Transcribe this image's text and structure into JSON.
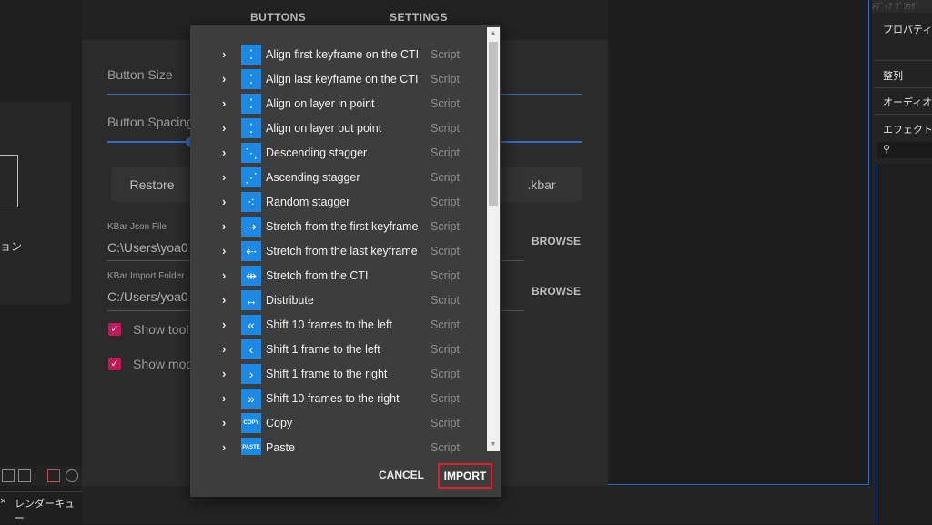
{
  "settings": {
    "tabs": [
      "BUTTONS",
      "SETTINGS"
    ],
    "button_size_label": "Button Size",
    "button_spacing_label": "Button Spacing",
    "restore_label": "Restore",
    "kbar_label": ".kbar",
    "json_file_label": "KBar Json File",
    "json_file_value": "C:\\Users\\yoa0",
    "import_folder_label": "KBar Import Folder",
    "import_folder_value": "C:/Users/yoa0",
    "browse_label": "BROWSE",
    "show_tool_label": "Show tool",
    "show_mod_label": "Show mod"
  },
  "left_panel": {
    "label": "ョン",
    "tab_label": "レンダーキュー",
    "tab_close": "×"
  },
  "right_panel": {
    "top_text": "ﾒﾃﾞｨｱ ﾌﾞﾗｳｻﾞ",
    "properties": "プロパティ:  ",
    "align": "整列",
    "audio": "オーディオ",
    "effects": "エフェクト＆",
    "search_icon": "⚲"
  },
  "modal": {
    "items": [
      {
        "name": "Align first keyframe on the CTI",
        "type": "Script",
        "icon": "align-first-keyframe-icon",
        "glyph": "⁚"
      },
      {
        "name": "Align last keyframe on the CTI",
        "type": "Script",
        "icon": "align-last-keyframe-icon",
        "glyph": "⁚"
      },
      {
        "name": "Align on layer in point",
        "type": "Script",
        "icon": "align-layer-in-icon",
        "glyph": "⁚"
      },
      {
        "name": "Align on layer out point",
        "type": "Script",
        "icon": "align-layer-out-icon",
        "glyph": "⁚"
      },
      {
        "name": "Descending stagger",
        "type": "Script",
        "icon": "descending-stagger-icon",
        "glyph": "⋱"
      },
      {
        "name": "Ascending stagger",
        "type": "Script",
        "icon": "ascending-stagger-icon",
        "glyph": "⋰"
      },
      {
        "name": "Random stagger",
        "type": "Script",
        "icon": "random-stagger-icon",
        "glyph": "⁖"
      },
      {
        "name": "Stretch from the first keyframe",
        "type": "Script",
        "icon": "stretch-first-icon",
        "glyph": "⇢"
      },
      {
        "name": "Stretch from the last keyframe",
        "type": "Script",
        "icon": "stretch-last-icon",
        "glyph": "⇠"
      },
      {
        "name": "Stretch from the CTI",
        "type": "Script",
        "icon": "stretch-cti-icon",
        "glyph": "⇹"
      },
      {
        "name": "Distribute",
        "type": "Script",
        "icon": "distribute-icon",
        "glyph": "↔"
      },
      {
        "name": "Shift 10 frames to the left",
        "type": "Script",
        "icon": "double-chevron-left-icon",
        "glyph": "«"
      },
      {
        "name": "Shift 1 frame to the left",
        "type": "Script",
        "icon": "chevron-left-icon",
        "glyph": "‹"
      },
      {
        "name": "Shift 1 frame to the right",
        "type": "Script",
        "icon": "chevron-right-icon",
        "glyph": "›"
      },
      {
        "name": "Shift 10 frames to the right",
        "type": "Script",
        "icon": "double-chevron-right-icon",
        "glyph": "»"
      },
      {
        "name": "Copy",
        "type": "Script",
        "icon": "copy-icon",
        "glyph": "COPY"
      },
      {
        "name": "Paste",
        "type": "Script",
        "icon": "paste-icon",
        "glyph": "PASTE"
      }
    ],
    "cancel_label": "CANCEL",
    "import_label": "IMPORT"
  },
  "colors": {
    "accent_blue": "#1e88e5",
    "checkbox_pink": "#c2185b",
    "highlight_red": "#e0202a"
  }
}
